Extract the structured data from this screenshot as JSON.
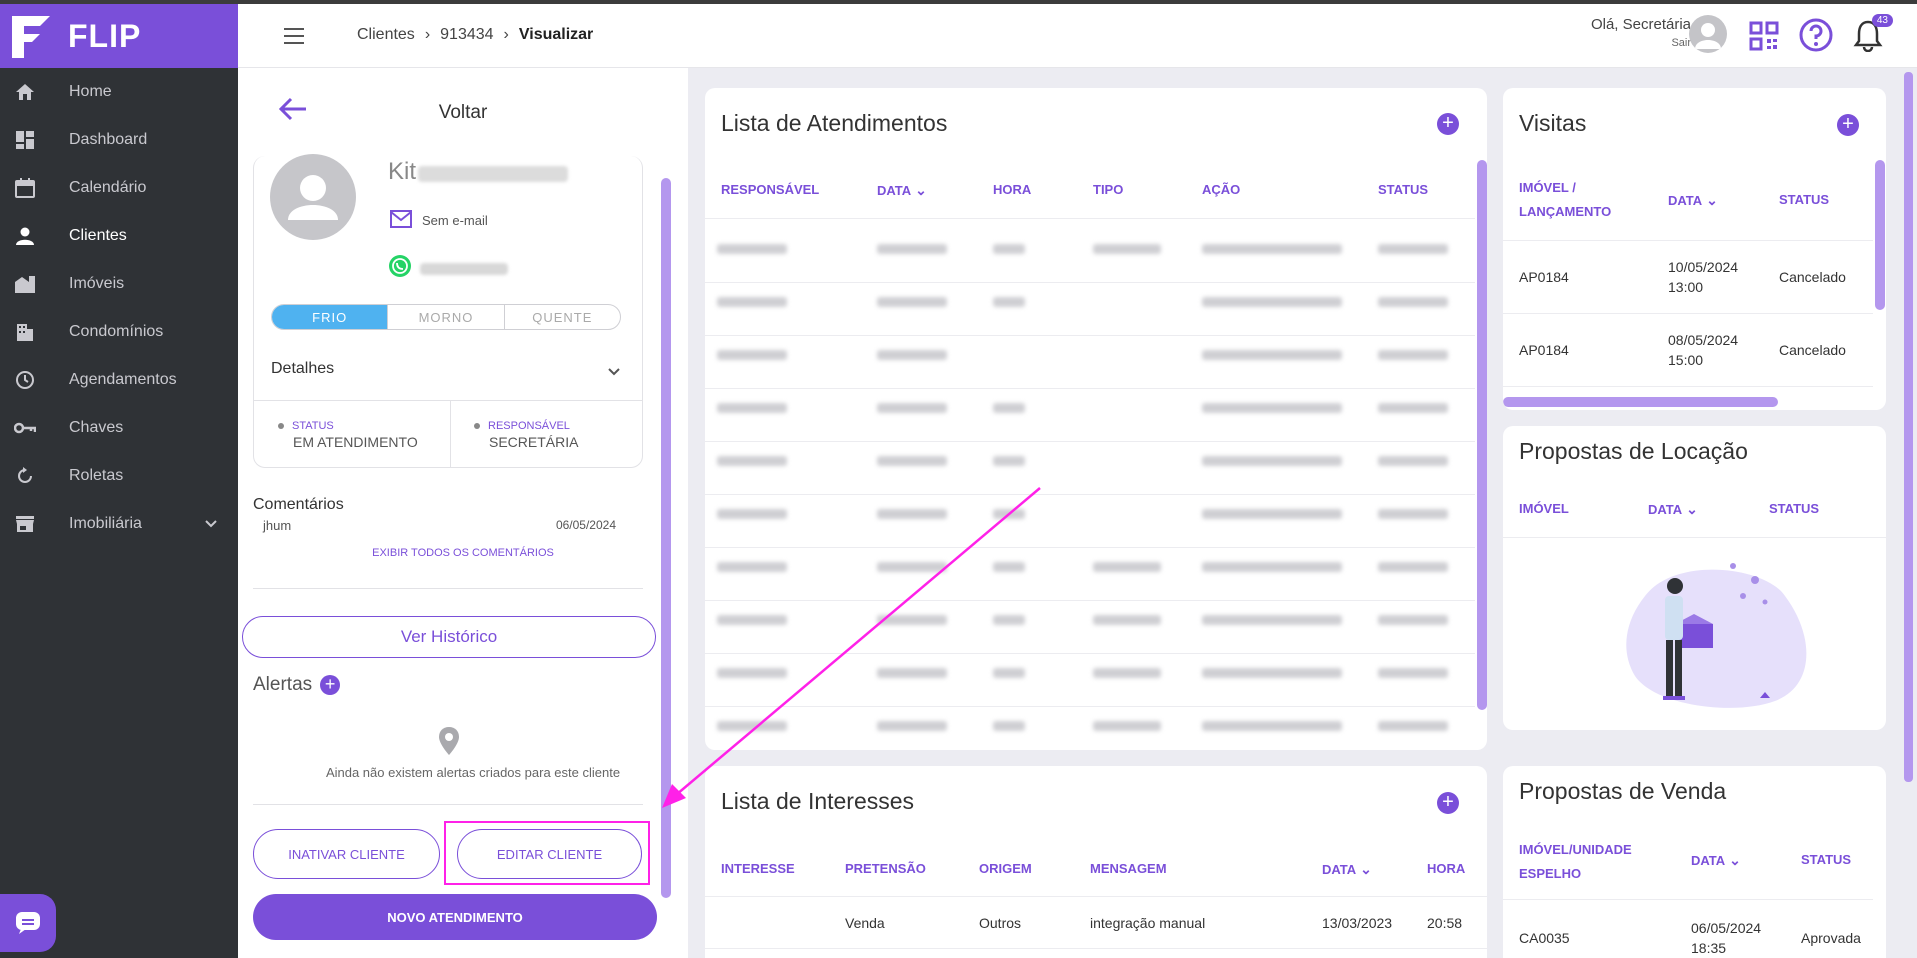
{
  "app": {
    "brand": "FLIP",
    "accent": "#7a4fd9",
    "sidebar_bg": "#2f3236"
  },
  "sidebar": {
    "items": [
      {
        "label": "Home",
        "icon": "home-icon"
      },
      {
        "label": "Dashboard",
        "icon": "dashboard-icon"
      },
      {
        "label": "Calendário",
        "icon": "calendar-icon"
      },
      {
        "label": "Clientes",
        "icon": "user-icon"
      },
      {
        "label": "Imóveis",
        "icon": "buildings-icon"
      },
      {
        "label": "Condomínios",
        "icon": "condo-icon"
      },
      {
        "label": "Agendamentos",
        "icon": "clock-icon"
      },
      {
        "label": "Chaves",
        "icon": "key-icon"
      },
      {
        "label": "Roletas",
        "icon": "rotate-icon"
      },
      {
        "label": "Imobiliária",
        "icon": "store-icon"
      }
    ]
  },
  "header": {
    "breadcrumb": [
      "Clientes",
      "913434",
      "Visualizar"
    ],
    "greeting": "Olá, Secretária",
    "logout": "Sair",
    "notifications": "43"
  },
  "client": {
    "back_label": "Voltar",
    "name": "Kit",
    "email": "Sem e-mail",
    "temperature": [
      "FRIO",
      "MORNO",
      "QUENTE"
    ],
    "details_label": "Detalhes",
    "status_label": "STATUS",
    "status_value": "EM ATENDIMENTO",
    "responsible_label": "RESPONSÁVEL",
    "responsible_value": "SECRETÁRIA",
    "comments_title": "Comentários",
    "comment_author": "jhum",
    "comment_date": "06/05/2024",
    "show_all_comments": "EXIBIR TODOS OS COMENTÁRIOS",
    "history_button": "Ver Histórico",
    "alerts_title": "Alertas",
    "no_alerts": "Ainda não existem alertas criados para este cliente",
    "inactivate_button": "INATIVAR CLIENTE",
    "edit_button": "EDITAR CLIENTE",
    "new_service_button": "NOVO ATENDIMENTO"
  },
  "atendimentos": {
    "title": "Lista de Atendimentos",
    "columns": [
      "RESPONSÁVEL",
      "DATA",
      "HORA",
      "TIPO",
      "AÇÃO",
      "STATUS"
    ]
  },
  "interesses": {
    "title": "Lista de Interesses",
    "columns": [
      "INTERESSE",
      "PRETENSÃO",
      "ORIGEM",
      "MENSAGEM",
      "DATA",
      "HORA"
    ],
    "rows": [
      {
        "interesse": "",
        "pretensao": "Venda",
        "origem": "Outros",
        "mensagem": "integração manual",
        "data": "13/03/2023",
        "hora": "20:58"
      }
    ]
  },
  "visitas": {
    "title": "Visitas",
    "columns": [
      "IMÓVEL / LANÇAMENTO",
      "DATA",
      "STATUS"
    ],
    "rows": [
      {
        "imovel": "AP0184",
        "data": "10/05/2024",
        "hora": "13:00",
        "status": "Cancelado"
      },
      {
        "imovel": "AP0184",
        "data": "08/05/2024",
        "hora": "15:00",
        "status": "Cancelado"
      }
    ]
  },
  "locacao": {
    "title": "Propostas de Locação",
    "columns": [
      "IMÓVEL",
      "DATA",
      "STATUS"
    ]
  },
  "venda": {
    "title": "Propostas de Venda",
    "columns": [
      "IMÓVEL/UNIDADE ESPELHO",
      "DATA",
      "STATUS"
    ],
    "rows": [
      {
        "imovel": "CA0035",
        "data": "06/05/2024",
        "hora": "18:35",
        "status": "Aprovada"
      }
    ]
  }
}
